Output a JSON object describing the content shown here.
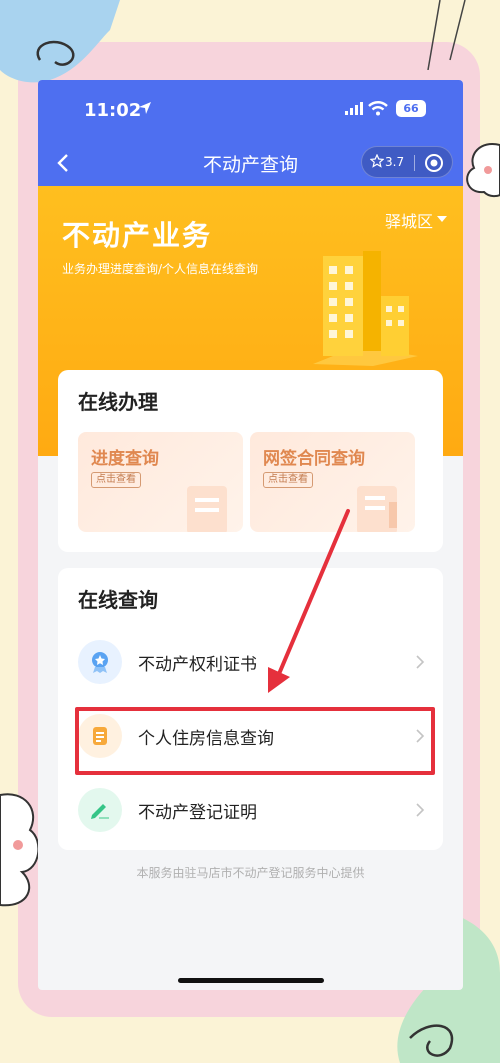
{
  "statusbar": {
    "time": "11:02",
    "battery": "66"
  },
  "navbar": {
    "title": "不动产查询",
    "rating": "3.7"
  },
  "hero": {
    "title": "不动产业务",
    "subtitle": "业务办理进度查询/个人信息在线查询",
    "district": "驿城区"
  },
  "online": {
    "title": "在线办理",
    "tiles": [
      {
        "label": "进度查询",
        "button": "点击查看"
      },
      {
        "label": "网签合同查询",
        "button": "点击查看"
      }
    ]
  },
  "query": {
    "title": "在线查询",
    "items": [
      {
        "label": "不动产权利证书",
        "icon": "certificate-icon"
      },
      {
        "label": "个人住房信息查询",
        "icon": "document-icon"
      },
      {
        "label": "不动产登记证明",
        "icon": "pen-icon"
      }
    ]
  },
  "footer": {
    "note": "本服务由驻马店市不动产登记服务中心提供"
  },
  "colors": {
    "nav_blue": "#4e6ff0",
    "hero_orange": "#ffaa12",
    "highlight_red": "#e5303c"
  }
}
